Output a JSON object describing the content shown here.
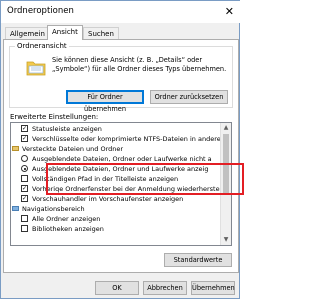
{
  "window": {
    "title": "Ordneroptionen",
    "close_glyph": "✕"
  },
  "tabs": [
    {
      "label": "Allgemein",
      "active": false
    },
    {
      "label": "Ansicht",
      "active": true
    },
    {
      "label": "Suchen",
      "active": false
    }
  ],
  "folder_view": {
    "group_label": "Ordneransicht",
    "description": "Sie können diese Ansicht (z. B. „Details“ oder „Symbole“) für alle Ordner dieses Typs übernehmen.",
    "apply_button": "Für Ordner übernehmen",
    "reset_button": "Ordner zurücksetzen"
  },
  "advanced": {
    "label": "Erweiterte Einstellungen:",
    "items": [
      {
        "type": "checkbox",
        "checked": true,
        "label": "Statusleiste anzeigen"
      },
      {
        "type": "checkbox",
        "checked": true,
        "label": "Verschlüsselte oder komprimierte NTFS-Dateien in anderer"
      },
      {
        "type": "folder",
        "label": "Versteckte Dateien und Ordner"
      },
      {
        "type": "radio",
        "selected": false,
        "label": "Ausgeblendete Dateien, Ordner oder Laufwerke nicht a"
      },
      {
        "type": "radio",
        "selected": true,
        "label": "Ausgeblendete Dateien, Ordner und Laufwerke anzeig"
      },
      {
        "type": "checkbox",
        "checked": false,
        "label": "Vollständigen Pfad in der Titelleiste anzeigen"
      },
      {
        "type": "checkbox",
        "checked": true,
        "label": "Vorheriqe Ordnerfenster bei der Anmeldung wiederherstellen"
      },
      {
        "type": "checkbox",
        "checked": true,
        "label": "Vorschauhandler im Vorschaufenster anzeigen"
      },
      {
        "type": "folder",
        "label": "Navigationsbereich"
      },
      {
        "type": "checkbox",
        "checked": false,
        "label": "Alle Ordner anzeigen"
      },
      {
        "type": "checkbox",
        "checked": false,
        "label": "Bibliotheken anzeigen"
      }
    ],
    "restore_button": "Standardwerte"
  },
  "footer": {
    "ok": "OK",
    "cancel": "Abbrechen",
    "apply": "Übernehmen"
  },
  "colors": {
    "highlight": "#e31e24",
    "focus": "#0078d7"
  }
}
